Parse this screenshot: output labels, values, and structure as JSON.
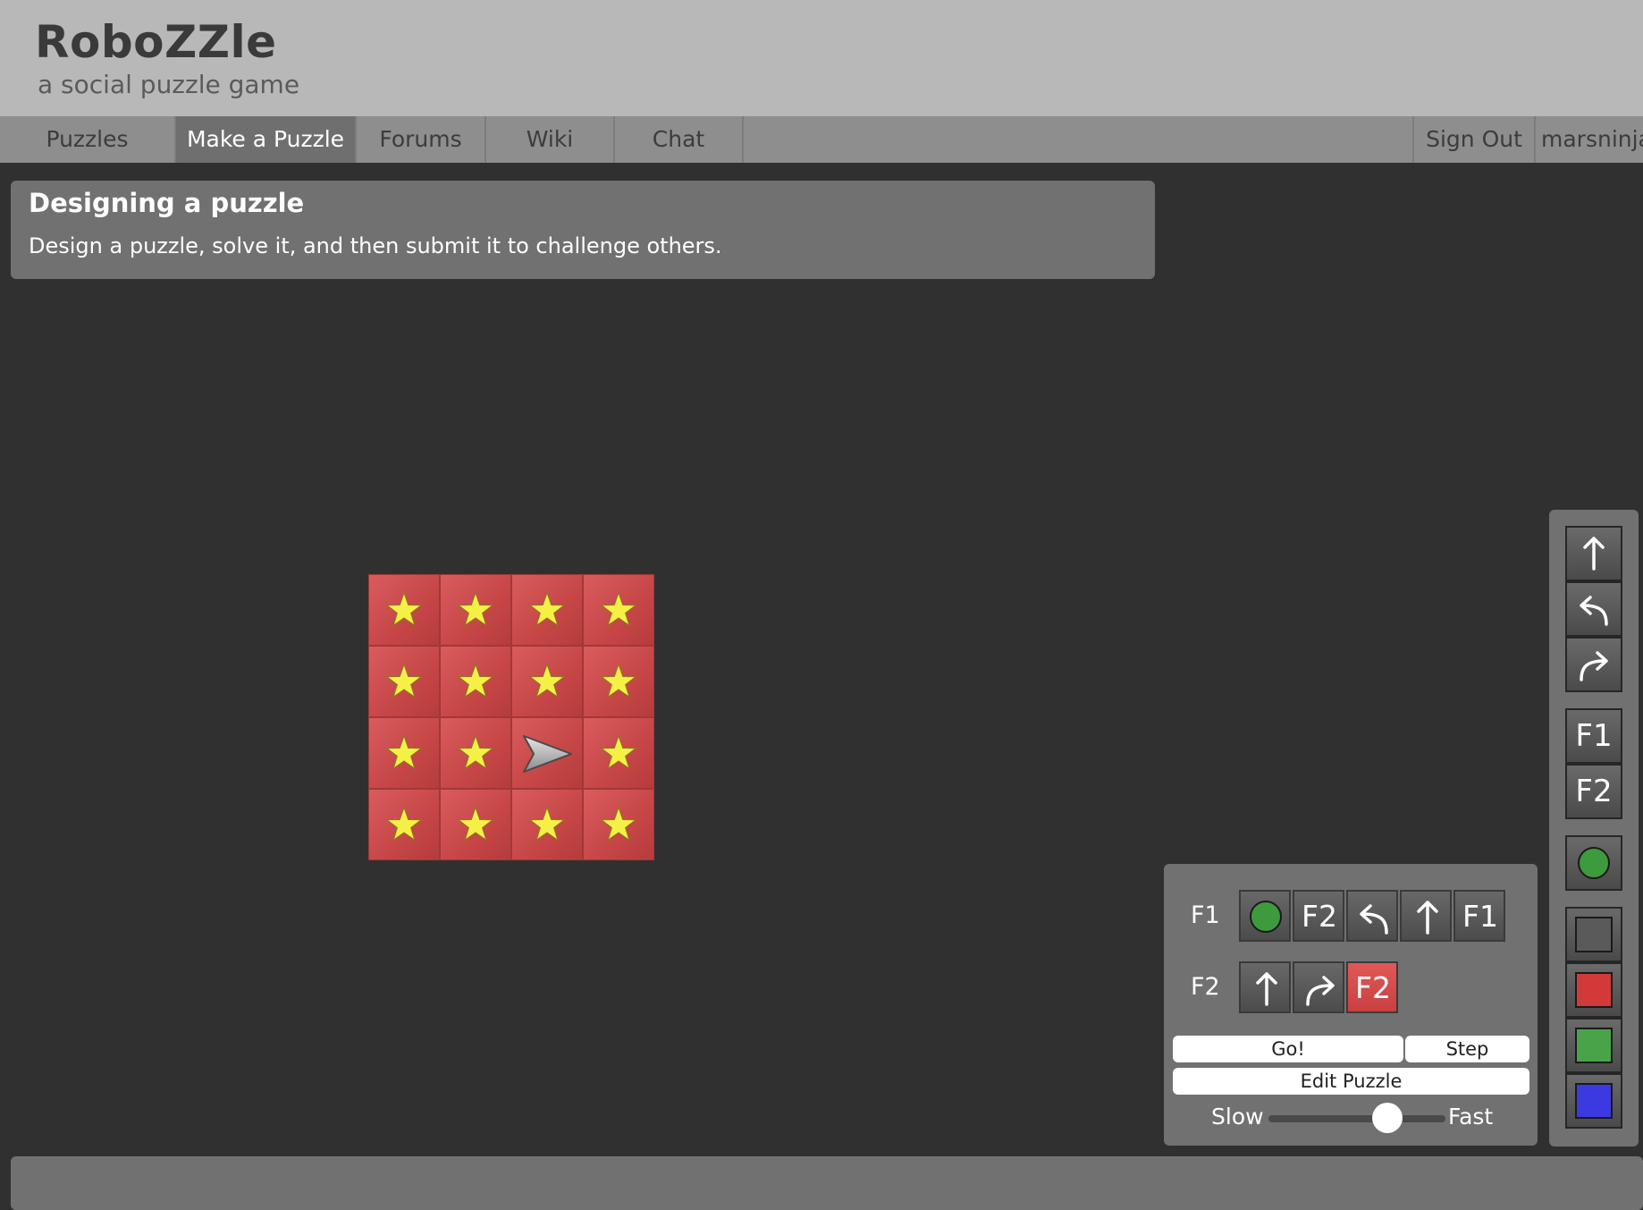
{
  "header": {
    "title": "RoboZZle",
    "subtitle": "a social puzzle game"
  },
  "nav": {
    "items": [
      {
        "label": "Puzzles",
        "active": false
      },
      {
        "label": "Make a Puzzle",
        "active": true
      },
      {
        "label": "Forums",
        "active": false
      },
      {
        "label": "Wiki",
        "active": false
      },
      {
        "label": "Chat",
        "active": false
      }
    ],
    "sign_out": "Sign Out",
    "username": "marsninja"
  },
  "info": {
    "title": "Designing a puzzle",
    "text": "Design a puzzle, solve it, and then submit it to challenge others."
  },
  "board": {
    "rows": 4,
    "cols": 4,
    "tile_color": "#cf4f4f",
    "star_color": "#f5f046",
    "robot": {
      "row": 2,
      "col": 2,
      "direction": "right"
    },
    "stars": [
      [
        true,
        true,
        true,
        true
      ],
      [
        true,
        true,
        true,
        true
      ],
      [
        true,
        true,
        false,
        true
      ],
      [
        true,
        true,
        true,
        true
      ]
    ]
  },
  "program": {
    "functions": [
      {
        "label": "F1",
        "slots": [
          {
            "type": "circle-icon"
          },
          {
            "type": "text",
            "text": "F2"
          },
          {
            "type": "turn-left-icon"
          },
          {
            "type": "forward-icon"
          },
          {
            "type": "text",
            "text": "F1"
          }
        ]
      },
      {
        "label": "F2",
        "slots": [
          {
            "type": "forward-icon"
          },
          {
            "type": "turn-right-icon"
          },
          {
            "type": "text",
            "text": "F2",
            "color": "red"
          }
        ]
      }
    ],
    "go_label": "Go!",
    "step_label": "Step",
    "edit_label": "Edit Puzzle",
    "slow_label": "Slow",
    "fast_label": "Fast",
    "speed": 0.67
  },
  "toolbox": {
    "instructions": [
      "forward-icon",
      "turn-left-icon",
      "turn-right-icon"
    ],
    "functions": [
      "F1",
      "F2"
    ],
    "paint": "circle-icon",
    "colors": [
      "#5a5a5a",
      "#d23a3a",
      "#49a449",
      "#3a3ae0"
    ]
  },
  "colors": {
    "background": "#303030",
    "panel": "#717171",
    "header": "#b8b8b8",
    "nav": "#8e8e8e",
    "paint_green": "#3d9a3d"
  }
}
